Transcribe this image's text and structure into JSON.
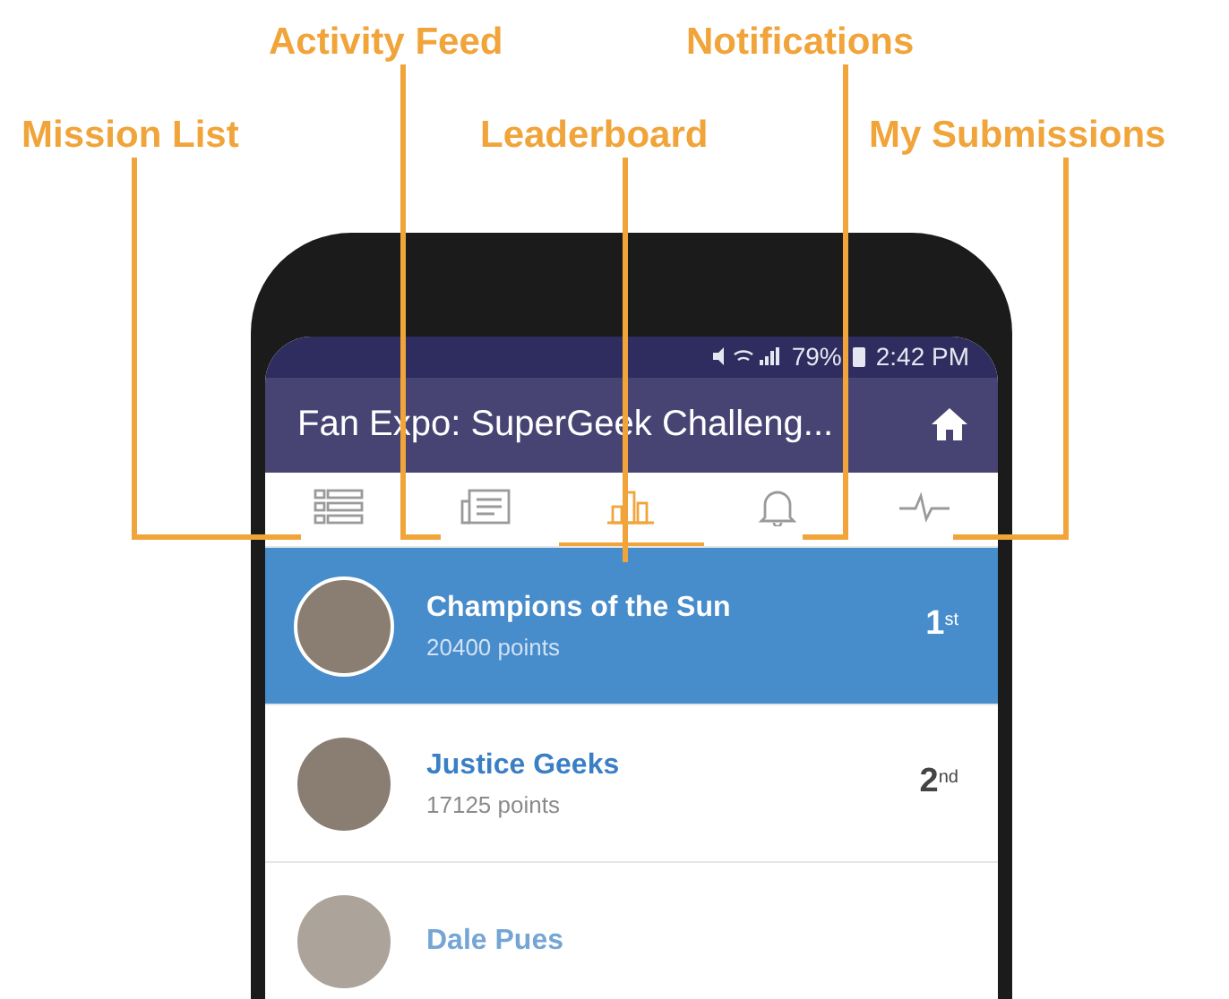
{
  "callouts": [
    {
      "label": "Mission List"
    },
    {
      "label": "Activity Feed"
    },
    {
      "label": "Leaderboard"
    },
    {
      "label": "Notifications"
    },
    {
      "label": "My Submissions"
    }
  ],
  "status_bar": {
    "battery": "79%",
    "time": "2:42 PM"
  },
  "header": {
    "title": "Fan Expo: SuperGeek Challeng..."
  },
  "tabs": [
    {
      "kind": "list",
      "selected": false
    },
    {
      "kind": "feed",
      "selected": false
    },
    {
      "kind": "chart",
      "selected": true
    },
    {
      "kind": "bell",
      "selected": false
    },
    {
      "kind": "pulse",
      "selected": false
    }
  ],
  "leaderboard": [
    {
      "name": "Champions of the Sun",
      "points": "20400 points",
      "rank": "1",
      "suffix": "st",
      "selected": true,
      "dimmed": false
    },
    {
      "name": "Justice Geeks",
      "points": "17125 points",
      "rank": "2",
      "suffix": "nd",
      "selected": false,
      "dimmed": false
    },
    {
      "name": "Dale Pues",
      "selected": false,
      "dimmed": true
    }
  ]
}
